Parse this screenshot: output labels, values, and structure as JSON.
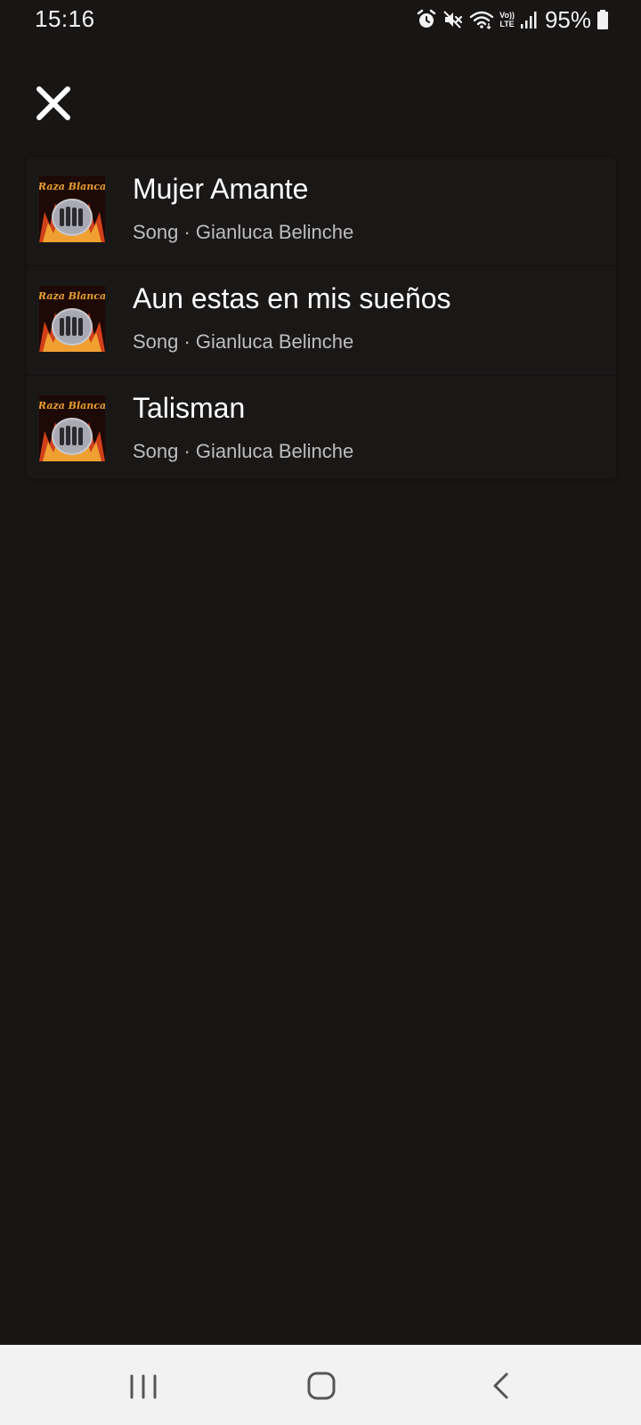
{
  "status_bar": {
    "time": "15:16",
    "battery_percent": "95%",
    "network_label_top": "Vo))",
    "network_label_bottom": "LTE",
    "icons": [
      "alarm-icon",
      "mute-icon",
      "wifi-icon",
      "volte-icon",
      "signal-icon",
      "battery-icon"
    ],
    "battery_level": 0.95
  },
  "header": {
    "close_icon": "close-icon"
  },
  "results": [
    {
      "title": "Mujer Amante",
      "subtitle": "Song · Gianluca Belinche",
      "art": "album-cover-raza-blanca"
    },
    {
      "title": "Aun estas en mis sueños",
      "subtitle": "Song · Gianluca Belinche",
      "art": "album-cover-raza-blanca"
    },
    {
      "title": "Talisman",
      "subtitle": "Song · Gianluca Belinche",
      "art": "album-cover-raza-blanca"
    }
  ],
  "album_cover_text": "Raza Blanca",
  "nav_bar": {
    "icons": [
      "recent-apps-icon",
      "home-icon",
      "back-icon"
    ]
  },
  "colors": {
    "background": "#181515",
    "card": "#1a1717",
    "title": "#ffffff",
    "subtitle": "#bdbdbd",
    "nav_background": "#f2f2f2"
  }
}
